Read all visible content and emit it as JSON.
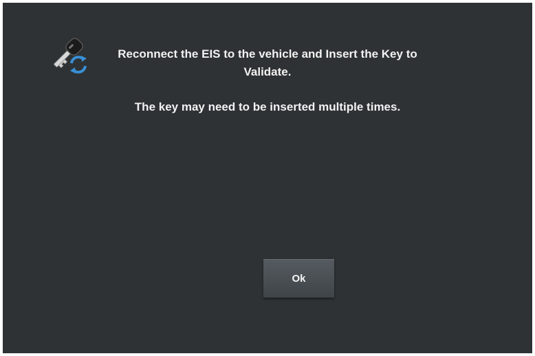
{
  "dialog": {
    "icon": "key-refresh-icon",
    "message_line1": "Reconnect the EIS to the vehicle and Insert the Key to Validate.",
    "message_line2": "The key may need to be inserted multiple times.",
    "ok_label": "Ok"
  },
  "colors": {
    "background": "#2e3234",
    "text": "#f2f2f2",
    "button": "#4a4f53",
    "refresh_icon": "#3a8fd6"
  }
}
